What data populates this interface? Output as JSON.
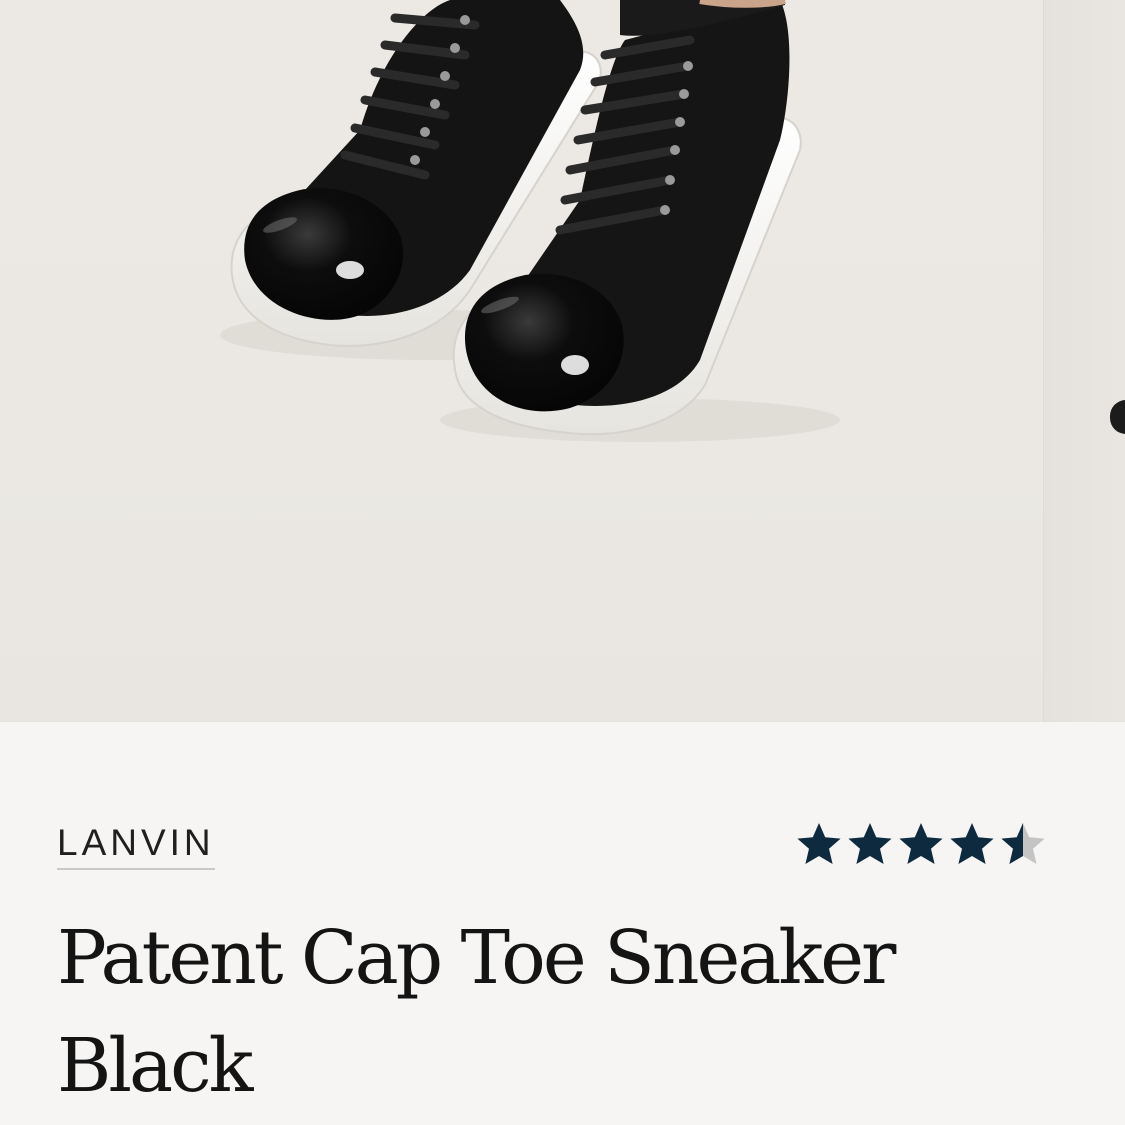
{
  "product": {
    "brand": "LANVIN",
    "title_line1": "Patent Cap Toe Sneaker",
    "title_line2": "Black",
    "rating": 4.5,
    "rating_max": 5,
    "star_color": "#0d2a3e",
    "star_empty_color": "#c4c4c4"
  },
  "gallery": {
    "main_image": "lanvin-patent-cap-toe-sneaker-black-photo",
    "next_image": "product-photo-peek"
  }
}
